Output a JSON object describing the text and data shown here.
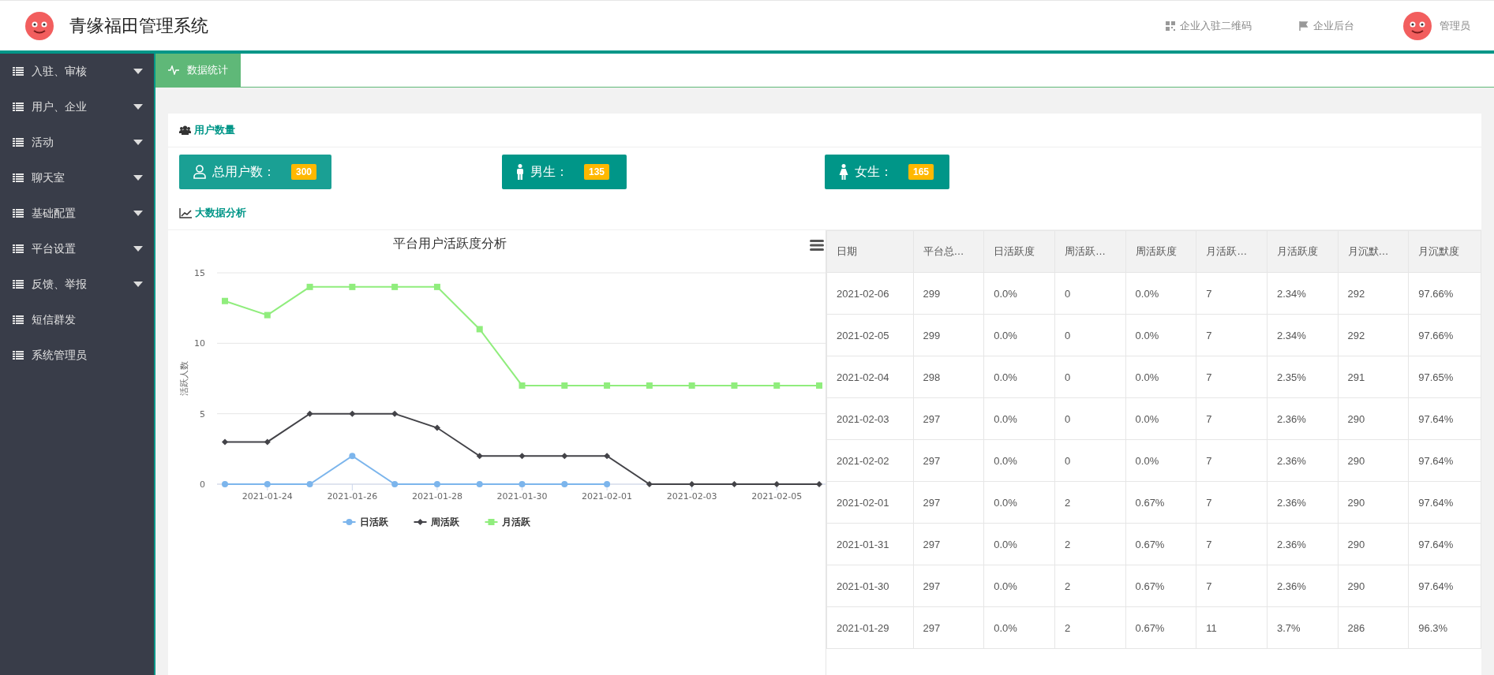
{
  "header": {
    "title": "青缘福田管理系统",
    "links": [
      {
        "kind": "qrcode",
        "label": "企业入驻二维码"
      },
      {
        "kind": "flag",
        "label": "企业后台"
      }
    ],
    "user": "管理员"
  },
  "sidebar": {
    "items": [
      {
        "label": "入驻、审核",
        "has_submenu": true
      },
      {
        "label": "用户、企业",
        "has_submenu": true
      },
      {
        "label": "活动",
        "has_submenu": true
      },
      {
        "label": "聊天室",
        "has_submenu": true
      },
      {
        "label": "基础配置",
        "has_submenu": true
      },
      {
        "label": "平台设置",
        "has_submenu": true
      },
      {
        "label": "反馈、举报",
        "has_submenu": true
      },
      {
        "label": "短信群发",
        "has_submenu": false
      },
      {
        "label": "系统管理员",
        "has_submenu": false
      }
    ]
  },
  "tabs": [
    {
      "label": "数据统计",
      "selected": true
    }
  ],
  "user_stats": {
    "title": "用户数量",
    "cards": [
      {
        "kind": "total",
        "label": "总用户数：",
        "count": "300"
      },
      {
        "kind": "male",
        "label": "男生：",
        "count": "135"
      },
      {
        "kind": "female",
        "label": "女生：",
        "count": "165"
      }
    ]
  },
  "analysis": {
    "title": "大数据分析",
    "chart": {
      "chart_data": {
        "type": "line",
        "title": "平台用户活跃度分析",
        "ylabel": "活跃人数",
        "categories": [
          null,
          "2021-01-24",
          null,
          "2021-01-26",
          null,
          "2021-01-28",
          null,
          "2021-01-30",
          null,
          "2021-02-01",
          null,
          "2021-02-03",
          null,
          "2021-02-05",
          null
        ],
        "legend": "bottom",
        "series": [
          {
            "name": "日活跃",
            "color": "#7cb5ec",
            "marker": "circle",
            "values": [
              0,
              0,
              0,
              2,
              0,
              0,
              0,
              0,
              0,
              0,
              null,
              null,
              null,
              null,
              null
            ]
          },
          {
            "name": "周活跃",
            "color": "#434348",
            "marker": "diamond",
            "values": [
              3,
              3,
              5,
              5,
              5,
              4,
              2,
              2,
              2,
              2,
              0,
              0,
              0,
              0,
              0
            ]
          },
          {
            "name": "月活跃",
            "color": "#90ed7d",
            "marker": "square",
            "values": [
              13,
              12,
              14,
              14,
              14,
              14,
              11,
              7,
              7,
              7,
              7,
              7,
              7,
              7,
              7
            ]
          }
        ],
        "ylim": [
          0,
          15
        ],
        "yticks": [
          0,
          5,
          10,
          15
        ]
      }
    },
    "table": {
      "columns": [
        "日期",
        "平台总…",
        "日活跃度",
        "周活跃…",
        "周活跃度",
        "月活跃…",
        "月活跃度",
        "月沉默…",
        "月沉默度"
      ],
      "rows": [
        [
          "2021-02-06",
          "299",
          "0.0%",
          "0",
          "0.0%",
          "7",
          "2.34%",
          "292",
          "97.66%"
        ],
        [
          "2021-02-05",
          "299",
          "0.0%",
          "0",
          "0.0%",
          "7",
          "2.34%",
          "292",
          "97.66%"
        ],
        [
          "2021-02-04",
          "298",
          "0.0%",
          "0",
          "0.0%",
          "7",
          "2.35%",
          "291",
          "97.65%"
        ],
        [
          "2021-02-03",
          "297",
          "0.0%",
          "0",
          "0.0%",
          "7",
          "2.36%",
          "290",
          "97.64%"
        ],
        [
          "2021-02-02",
          "297",
          "0.0%",
          "0",
          "0.0%",
          "7",
          "2.36%",
          "290",
          "97.64%"
        ],
        [
          "2021-02-01",
          "297",
          "0.0%",
          "2",
          "0.67%",
          "7",
          "2.36%",
          "290",
          "97.64%"
        ],
        [
          "2021-01-31",
          "297",
          "0.0%",
          "2",
          "0.67%",
          "7",
          "2.36%",
          "290",
          "97.64%"
        ],
        [
          "2021-01-30",
          "297",
          "0.0%",
          "2",
          "0.67%",
          "7",
          "2.36%",
          "290",
          "97.64%"
        ],
        [
          "2021-01-29",
          "297",
          "0.0%",
          "2",
          "0.67%",
          "11",
          "3.7%",
          "286",
          "96.3%"
        ]
      ]
    }
  }
}
